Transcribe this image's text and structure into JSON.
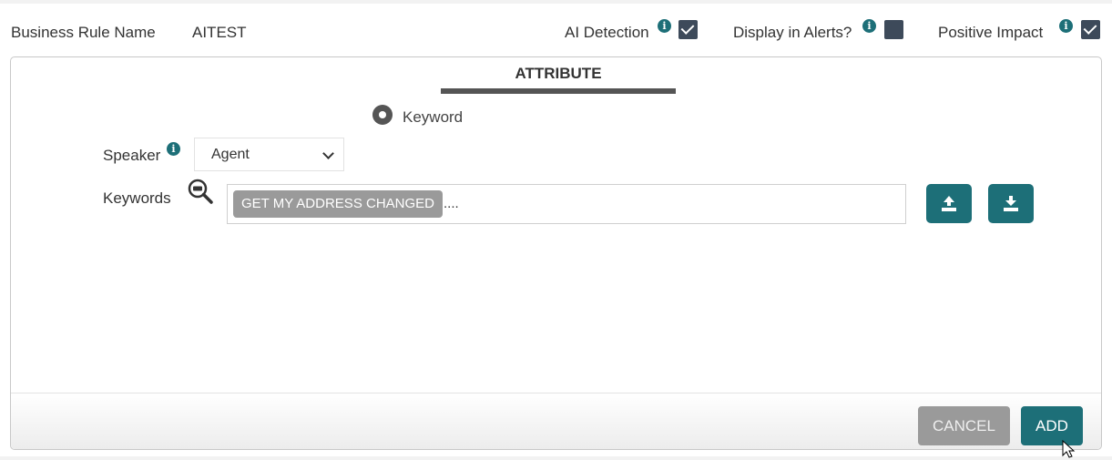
{
  "header": {
    "rule_name_label": "Business Rule Name",
    "rule_name_value": "AITEST",
    "ai_detection_label": "AI Detection",
    "ai_detection_checked": true,
    "display_alerts_label": "Display in Alerts?",
    "display_alerts_checked": false,
    "positive_impact_label": "Positive Impact",
    "positive_impact_checked": true,
    "info_glyph": "i"
  },
  "attribute": {
    "title": "ATTRIBUTE",
    "radio_label": "Keyword",
    "speaker_label": "Speaker",
    "speaker_value": "Agent",
    "keywords_label": "Keywords",
    "keyword_tags": [
      "GET MY ADDRESS CHANGED"
    ],
    "keyword_input_value": "...."
  },
  "footer": {
    "cancel_label": "CANCEL",
    "add_label": "ADD"
  },
  "colors": {
    "accent": "#1d6f78",
    "checkbox": "#3d4a5a",
    "disabled": "#9a9a9a"
  },
  "icons": [
    "info-icon",
    "check-icon",
    "search-icon",
    "upload-icon",
    "download-icon",
    "chevron-down-icon",
    "cursor-icon"
  ]
}
